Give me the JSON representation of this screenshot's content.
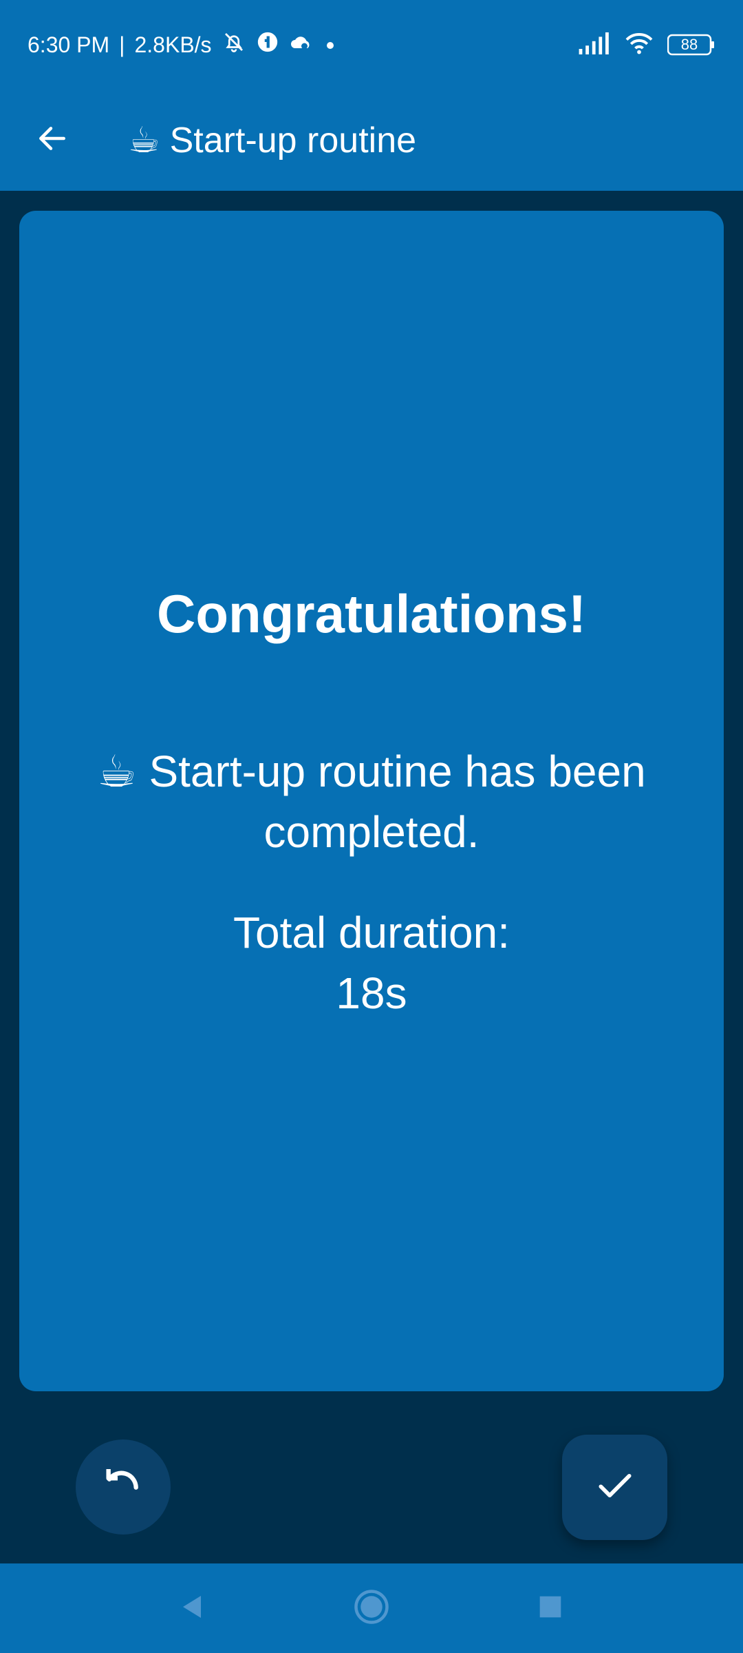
{
  "status_bar": {
    "time": "6:30 PM",
    "separator": "|",
    "speed": "2.8KB/s",
    "battery": "88",
    "icons": [
      "bell-off-icon",
      "app-icon",
      "cloud-icon",
      "dot-icon",
      "signal-icon",
      "wifi-icon",
      "battery-icon"
    ]
  },
  "app_bar": {
    "title_emoji": "☕",
    "title": "Start-up routine",
    "back_icon": "arrow-left-icon"
  },
  "card": {
    "heading": "Congratulations!",
    "completed_emoji": "☕",
    "completed_text": "Start-up routine has been completed.",
    "duration_label": "Total duration:",
    "duration_value": "18s"
  },
  "actions": {
    "undo_icon": "undo-icon",
    "done_icon": "check-icon"
  },
  "nav_bar": {
    "icons": [
      "nav-back-icon",
      "nav-home-icon",
      "nav-recents-icon"
    ]
  },
  "colors": {
    "primary": "#0670b4",
    "background": "#002f4c",
    "fab": "#0b416a",
    "text": "#ffffff"
  }
}
